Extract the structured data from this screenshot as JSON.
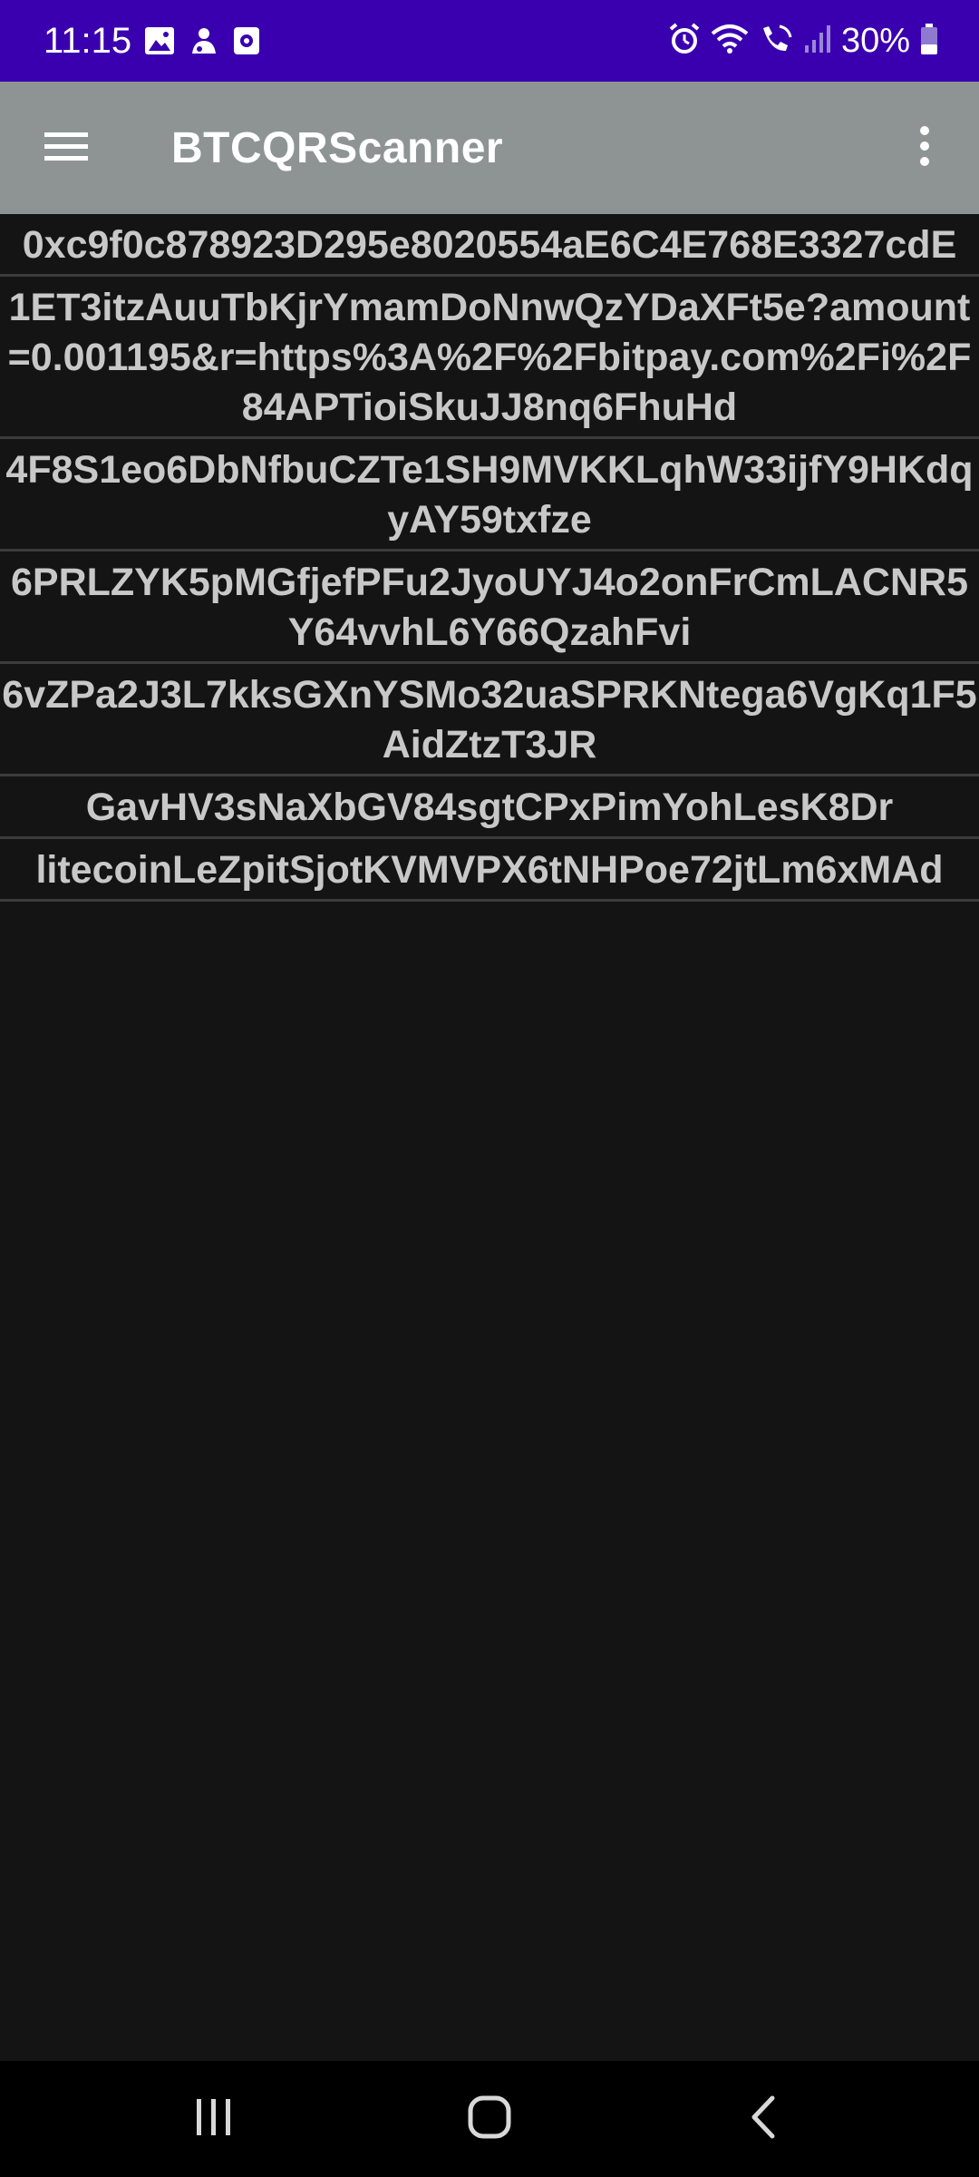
{
  "status_bar": {
    "time": "11:15",
    "battery_percent": "30%",
    "background": "#3a00b0",
    "left_icons": [
      "gallery-icon",
      "notification-icon",
      "screen-recorder-icon"
    ],
    "right_icons": [
      "alarm-icon",
      "wifi-icon",
      "wifi-calling-icon",
      "signal-icon",
      "battery-icon"
    ]
  },
  "app_bar": {
    "title": "BTCQRScanner",
    "background": "#8e9494",
    "menu_icon": "hamburger-menu-icon",
    "overflow_icon": "more-vert-icon"
  },
  "scanned_codes": [
    "0xc9f0c878923D295e8020554aE6C4E768E3327cdE",
    "1ET3itzAuuTbKjrYmamDoNnwQzYDaXFt5e?amount=0.001195&r=https%3A%2F%2Fbitpay.com%2Fi%2F84APTioiSkuJJ8nq6FhuHd",
    "4F8S1eo6DbNfbuCZTe1SH9MVKKLqhW33ijfY9HKdqyAY59txfze",
    "6PRLZYK5pMGfjefPFu2JyoUYJ4o2onFrCmLACNR5Y64vvhL6Y66QzahFvi",
    "6vZPa2J3L7kksGXnYSMo32uaSPRKNtega6VgKq1F5AidZtzT3JR",
    "GavHV3sNaXbGV84sgtCPxPimYohLesK8Dr",
    "litecoinLeZpitSjotKVMVPX6tNHPoe72jtLm6xMAd"
  ],
  "nav_bar": {
    "icons": [
      "recent-apps-icon",
      "home-icon",
      "back-icon"
    ]
  }
}
